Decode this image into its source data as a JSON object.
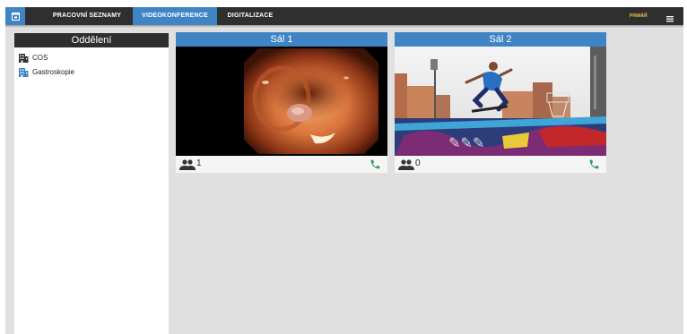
{
  "nav": {
    "tabs": [
      {
        "label": "PRACOVNÍ SEZNAMY",
        "active": false
      },
      {
        "label": "VIDEOKONFERENCE",
        "active": true
      },
      {
        "label": "DIGITALIZACE",
        "active": false
      }
    ],
    "user": "PRIMÁŘ",
    "accent_color": "#3f85c6",
    "bar_color": "#2f2f2f",
    "app_icon": "window-icon",
    "menu_icon": "hamburger-icon"
  },
  "sidebar": {
    "title": "Oddělení",
    "items": [
      {
        "label": "COS",
        "icon": "building-icon",
        "icon_color": "#333333"
      },
      {
        "label": "Gastroskopie",
        "icon": "building-icon",
        "icon_color": "#3f85c6"
      }
    ]
  },
  "rooms": [
    {
      "title": "Sál 1",
      "participants": "1",
      "video": "endoscopy-feed",
      "participants_icon": "people-icon",
      "call_icon": "phone-icon"
    },
    {
      "title": "Sál 2",
      "participants": "0",
      "video": "skateboard-feed",
      "participants_icon": "people-icon",
      "call_icon": "phone-icon"
    }
  ],
  "colors": {
    "call_green": "#2e9e5b"
  }
}
